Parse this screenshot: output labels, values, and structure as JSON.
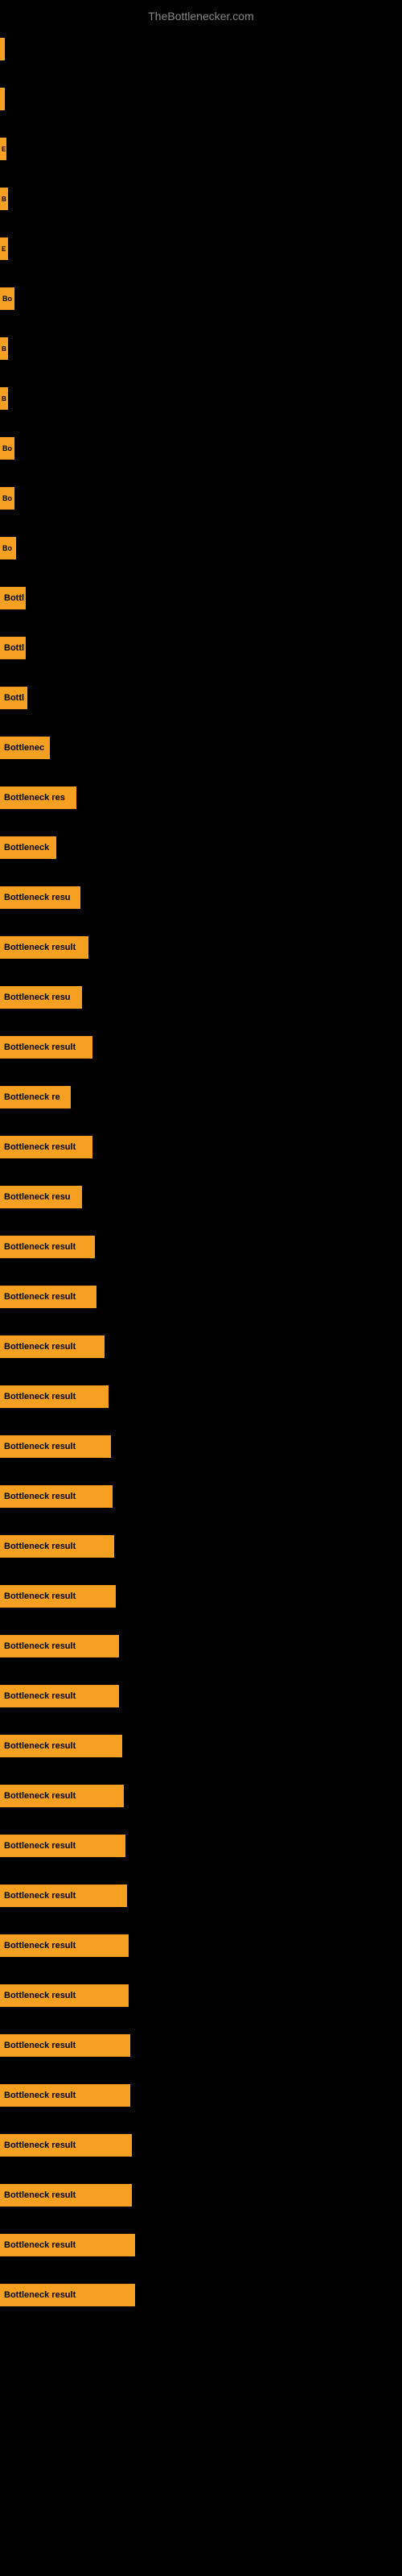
{
  "site": {
    "title": "TheBottlenecker.com"
  },
  "bars": [
    {
      "id": 1,
      "label": "",
      "width": 6
    },
    {
      "id": 2,
      "label": "",
      "width": 6
    },
    {
      "id": 3,
      "label": "E",
      "width": 8
    },
    {
      "id": 4,
      "label": "B",
      "width": 10
    },
    {
      "id": 5,
      "label": "E",
      "width": 10
    },
    {
      "id": 6,
      "label": "Bo",
      "width": 18
    },
    {
      "id": 7,
      "label": "B",
      "width": 10
    },
    {
      "id": 8,
      "label": "B",
      "width": 10
    },
    {
      "id": 9,
      "label": "Bo",
      "width": 18
    },
    {
      "id": 10,
      "label": "Bo",
      "width": 18
    },
    {
      "id": 11,
      "label": "Bo",
      "width": 20
    },
    {
      "id": 12,
      "label": "Bottl",
      "width": 32
    },
    {
      "id": 13,
      "label": "Bottl",
      "width": 32
    },
    {
      "id": 14,
      "label": "Bottl",
      "width": 34
    },
    {
      "id": 15,
      "label": "Bottlenec",
      "width": 62
    },
    {
      "id": 16,
      "label": "Bottleneck res",
      "width": 95
    },
    {
      "id": 17,
      "label": "Bottleneck",
      "width": 70
    },
    {
      "id": 18,
      "label": "Bottleneck resu",
      "width": 100
    },
    {
      "id": 19,
      "label": "Bottleneck result",
      "width": 110
    },
    {
      "id": 20,
      "label": "Bottleneck resu",
      "width": 102
    },
    {
      "id": 21,
      "label": "Bottleneck result",
      "width": 115
    },
    {
      "id": 22,
      "label": "Bottleneck re",
      "width": 88
    },
    {
      "id": 23,
      "label": "Bottleneck result",
      "width": 115
    },
    {
      "id": 24,
      "label": "Bottleneck resu",
      "width": 102
    },
    {
      "id": 25,
      "label": "Bottleneck result",
      "width": 118
    },
    {
      "id": 26,
      "label": "Bottleneck result",
      "width": 120
    },
    {
      "id": 27,
      "label": "Bottleneck result",
      "width": 130
    },
    {
      "id": 28,
      "label": "Bottleneck result",
      "width": 135
    },
    {
      "id": 29,
      "label": "Bottleneck result",
      "width": 138
    },
    {
      "id": 30,
      "label": "Bottleneck result",
      "width": 140
    },
    {
      "id": 31,
      "label": "Bottleneck result",
      "width": 142
    },
    {
      "id": 32,
      "label": "Bottleneck result",
      "width": 144
    },
    {
      "id": 33,
      "label": "Bottleneck result",
      "width": 148
    },
    {
      "id": 34,
      "label": "Bottleneck result",
      "width": 148
    },
    {
      "id": 35,
      "label": "Bottleneck result",
      "width": 152
    },
    {
      "id": 36,
      "label": "Bottleneck result",
      "width": 154
    },
    {
      "id": 37,
      "label": "Bottleneck result",
      "width": 156
    },
    {
      "id": 38,
      "label": "Bottleneck result",
      "width": 158
    },
    {
      "id": 39,
      "label": "Bottleneck result",
      "width": 160
    },
    {
      "id": 40,
      "label": "Bottleneck result",
      "width": 160
    },
    {
      "id": 41,
      "label": "Bottleneck result",
      "width": 162
    },
    {
      "id": 42,
      "label": "Bottleneck result",
      "width": 162
    },
    {
      "id": 43,
      "label": "Bottleneck result",
      "width": 164
    },
    {
      "id": 44,
      "label": "Bottleneck result",
      "width": 164
    },
    {
      "id": 45,
      "label": "Bottleneck result",
      "width": 168
    },
    {
      "id": 46,
      "label": "Bottleneck result",
      "width": 168
    }
  ]
}
